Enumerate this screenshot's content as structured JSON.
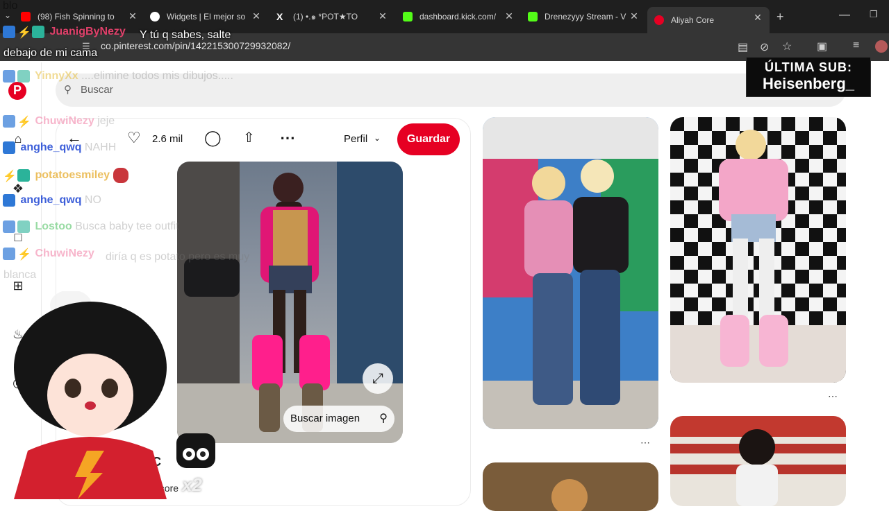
{
  "browser": {
    "tabs": [
      {
        "title": "(98) Fish Spinning to",
        "icon": "youtube-icon",
        "color": "#ff0000"
      },
      {
        "title": "Widgets | El mejor so",
        "icon": "widgets-icon",
        "color": "#ffffff"
      },
      {
        "title": "(1) •.๑ *POT★TO",
        "icon": "x-icon",
        "color": "#ffffff"
      },
      {
        "title": "dashboard.kick.com/",
        "icon": "kick-icon",
        "color": "#53fc18"
      },
      {
        "title": "Drenezyyy Stream - V",
        "icon": "kick-icon",
        "color": "#53fc18"
      },
      {
        "title": "Aliyah Core",
        "icon": "pinterest-icon",
        "color": "#e60023"
      }
    ],
    "url": "co.pinterest.com/pin/142215300729932082/"
  },
  "pinterest": {
    "search_placeholder": "Buscar",
    "likes": "2.6 mil",
    "profile_label": "Perfil",
    "save_label": "Guardar",
    "search_image_label": "Buscar imagen",
    "owner_partial": "h C",
    "board_partial": "ncore"
  },
  "overlay": {
    "top_text": "blo",
    "chat": [
      {
        "user": "JuanigByNezy",
        "msg": "Y tú q sabes, salte debajo de mi cama"
      },
      {
        "user": "YinnyXx",
        "msg": "....elimine todos mis dibujos....."
      },
      {
        "user": "ChuwiNezy",
        "msg": "jeje"
      },
      {
        "user": "anghe_qwq",
        "msg": "NAHH"
      },
      {
        "user": "potatoesmiley",
        "msg": ""
      },
      {
        "user": "anghe_qwq",
        "msg": "NO"
      },
      {
        "user": "Lostoo",
        "msg": "Busca baby tee outfit"
      },
      {
        "user": "ChuwiNezy",
        "msg": "diría q es potato pero es muy blanca"
      }
    ],
    "last_sub_label": "ÚLTIMA SUB:",
    "last_sub_name": "Heisenberg_",
    "multiplier": "x2"
  }
}
